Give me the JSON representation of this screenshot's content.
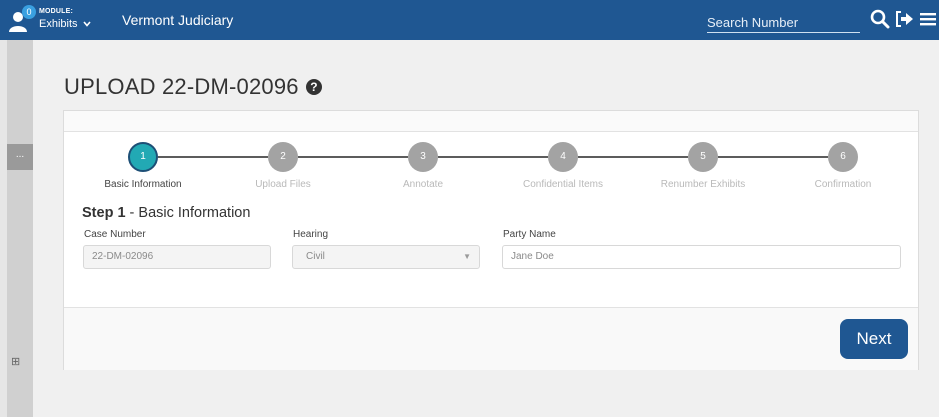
{
  "header": {
    "notification_count": "0",
    "module_label": "MODULE:",
    "module_value": "Exhibits",
    "app_name": "Vermont Judiciary",
    "search_placeholder": "Search Number"
  },
  "page": {
    "title": "UPLOAD 22-DM-02096"
  },
  "sidebar": {
    "ellipsis": "..."
  },
  "stepper": {
    "steps": [
      {
        "number": "1",
        "label": "Basic Information"
      },
      {
        "number": "2",
        "label": "Upload Files"
      },
      {
        "number": "3",
        "label": "Annotate"
      },
      {
        "number": "4",
        "label": "Confidential Items"
      },
      {
        "number": "5",
        "label": "Renumber Exhibits"
      },
      {
        "number": "6",
        "label": "Confirmation"
      }
    ],
    "active_step": 1
  },
  "form": {
    "step_prefix": "Step 1",
    "step_title": " - Basic Information",
    "case_number_label": "Case Number",
    "case_number_value": "22-DM-02096",
    "hearing_label": "Hearing",
    "hearing_value": "Civil",
    "party_name_label": "Party Name",
    "party_name_value": "Jane Doe"
  },
  "footer": {
    "next_label": "Next"
  },
  "colors": {
    "brand": "#1f5792",
    "active_step": "#22a9b4",
    "inactive_step": "#a3a3a3"
  }
}
